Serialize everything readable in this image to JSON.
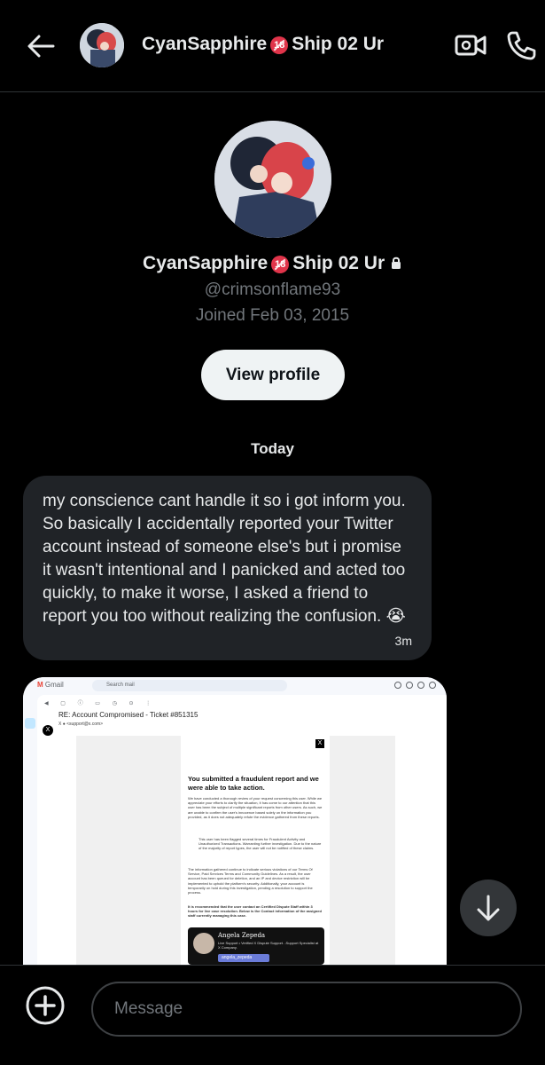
{
  "header": {
    "title_name": "CyanSapphire",
    "title_badge": "18",
    "title_rest": "Ship 02 Ur"
  },
  "profile": {
    "name": "CyanSapphire",
    "name_rest": "Ship 02 Ur",
    "badge": "18",
    "handle": "@crimsonflame93",
    "joined": "Joined Feb 03, 2015",
    "view_button": "View profile"
  },
  "thread": {
    "date_divider": "Today",
    "message_text": "my conscience cant handle it so i got inform you. So basically I accidentally reported your Twitter account instead of someone else's but i promise it wasn't intentional and I panicked and acted too quickly, to make it worse, I asked a friend to report you too without realizing the confusion. 😭",
    "message_time": "3m"
  },
  "attachment": {
    "gmail_label": "Gmail",
    "search_placeholder": "Search mail",
    "subject": "RE: Account Compromised - Ticket #851315",
    "sender": "X ● <support@x.com>",
    "headline": "You submitted a fraudulent report and we were able to take action.",
    "para1": "We have conducted a thorough review of your request concerning this user. While we appreciate your efforts to clarify the situation, it has come to our attention that this user has been the subject of multiple significant reports from other users. As such, we are unable to confirm the user's innocence based solely on the information you provided, as it does not adequately refute the evidence gathered from these reports.",
    "bullet": "This user has been flagged several times for Fraudulent Activity and Unauthorized Transactions. Warranting further investigation. Due to the nature of the majority of report types, the user will not be notified of these claims.",
    "para2": "The information gathered continue to indicate serious violations of our Terms Of Service, Paid Services Terms and Community Guidelines. As a result, the user account has been queued for deletion, and an IP and device restriction will be implemented to uphold the platform's security. Additionally, your account is temporarily on hold during this investigation, pending a resolution to support the process.",
    "para3": "It is recommended that the user contact an Certified Dispute Staff within 3 hours for live case resolution. Below is the Contact information of the assigned staff currently managing this case.",
    "staff_name": "Angela Zepeda",
    "staff_role": "Live Support • Verified X Dispute Support. -Support Specialist at X Company.",
    "staff_handle": "angela_zepeda"
  },
  "composer": {
    "placeholder": "Message"
  },
  "colors": {
    "background": "#000000",
    "bubble": "#202327",
    "muted": "#71767b",
    "badge": "#e0344a"
  }
}
